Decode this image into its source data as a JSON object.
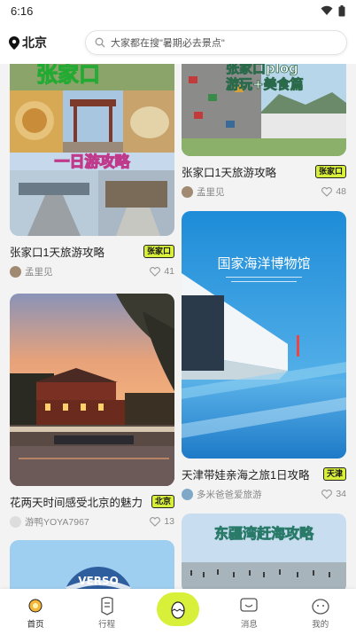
{
  "status": {
    "time": "6:16"
  },
  "header": {
    "city": "北京",
    "search_placeholder": "大家都在搜\"暑期必去景点\""
  },
  "cards": {
    "c1": {
      "title": "张家口1天旅游攻略",
      "tag": "张家口",
      "author": "孟里见",
      "likes": "41",
      "overlay_text": "一日游攻略",
      "top_text": "张家口"
    },
    "c2": {
      "title": "花两天时间感受北京的魅力",
      "tag": "北京",
      "author": "游鸭YOYA7967",
      "likes": "13"
    },
    "c3": {
      "title": "",
      "tag": "",
      "author": "",
      "likes": ""
    },
    "c4": {
      "title": "张家口1天旅游攻略",
      "tag": "张家口",
      "author": "孟里见",
      "likes": "48",
      "overlay_text1": "张家口plog",
      "overlay_text2": "游玩+美食篇"
    },
    "c5": {
      "title": "天津带娃亲海之旅1日攻略",
      "tag": "天津",
      "author": "多米爸爸爱旅游",
      "likes": "34",
      "overlay_text": "国家海洋博物馆"
    },
    "c6": {
      "overlay_text": "东疆湾赶海攻略"
    }
  },
  "nav": {
    "home": "首页",
    "trip": "行程",
    "message": "消息",
    "mine": "我的"
  },
  "colors": {
    "accent": "#d8f03a"
  }
}
